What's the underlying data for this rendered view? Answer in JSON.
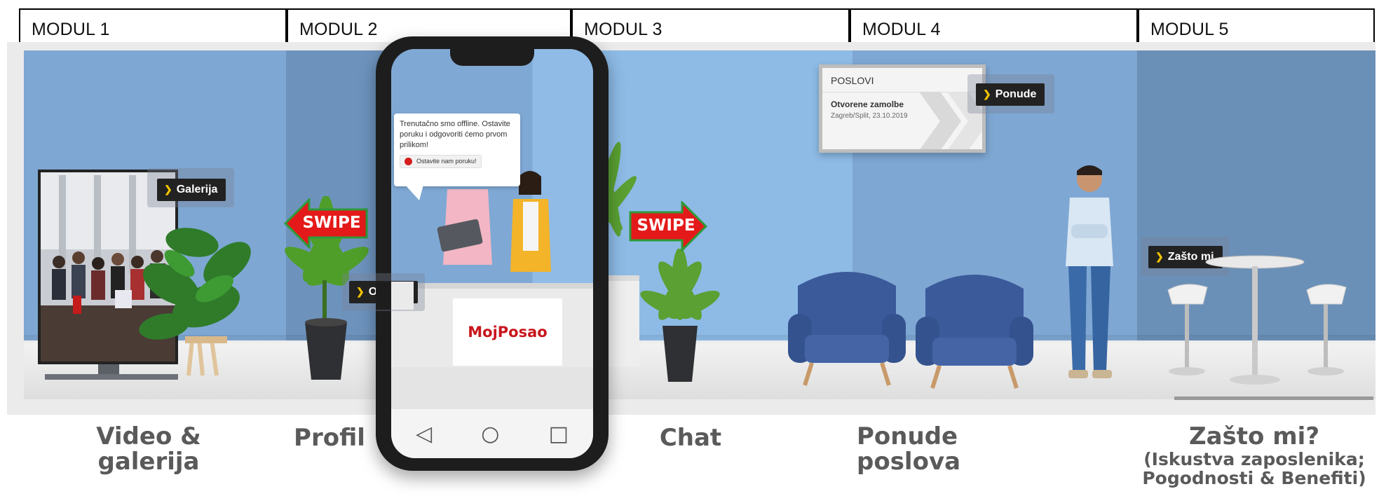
{
  "modules": [
    {
      "label": "MODUL 1"
    },
    {
      "label": "MODUL 2"
    },
    {
      "label": "MODUL 3"
    },
    {
      "label": "MODUL 4"
    },
    {
      "label": "MODUL 5"
    }
  ],
  "tags": {
    "galerija": "Galerija",
    "onama": "O nama",
    "ponude": "Ponude",
    "zasto": "Zašto mi"
  },
  "swipe": {
    "left": "SWIPE",
    "right": "SWIPE"
  },
  "chat_popup": {
    "message": "Trenutačno smo offline. Ostavite poruku i odgovoriti ćemo prvom prilikom!",
    "button": "Ostavite nam poruku!"
  },
  "booth": {
    "brand": "MojPosao"
  },
  "jobs_board": {
    "title": "POSLOVI",
    "item_title": "Otvorene zamolbe",
    "item_meta": "Zagreb/Split, 23.10.2019"
  },
  "captions": {
    "video_line1": "Video &",
    "video_line2": "galerija",
    "profil": "Profil",
    "chat": "Chat",
    "ponude_line1": "Ponude",
    "ponude_line2": "poslova",
    "zasto_title": "Zašto mi?",
    "zasto_sub1": "(Iskustva zaposlenika;",
    "zasto_sub2": "Pogodnosti & Benefiti)"
  },
  "colors": {
    "wall_mid": "#7ea7d3",
    "wall_light": "#8dbbe6",
    "wall_dark": "#6b90b8",
    "accent_yellow": "#f2c300",
    "swipe_red": "#e41a1a",
    "swipe_outline": "#2e9a3a",
    "brand_red": "#c8161d",
    "caption_gray": "#5a5a5a"
  }
}
